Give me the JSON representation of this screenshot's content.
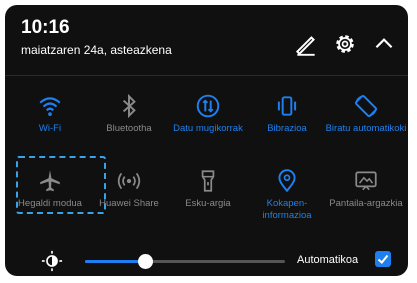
{
  "header": {
    "time": "10:16",
    "date": "maiatzaren 24a, asteazkena",
    "edit_icon": "pencil-edit-icon",
    "settings_icon": "gear-icon",
    "collapse_icon": "chevron-up-icon"
  },
  "tiles": [
    {
      "label": "Wi-Fi",
      "icon": "wifi-icon",
      "active": true
    },
    {
      "label": "Bluetootha",
      "icon": "bluetooth-icon",
      "active": false
    },
    {
      "label": "Datu mugikorrak",
      "icon": "mobile-data-icon",
      "active": true
    },
    {
      "label": "Bibrazioa",
      "icon": "vibration-icon",
      "active": true
    },
    {
      "label": "Biratu automatikoki",
      "icon": "auto-rotate-icon",
      "active": true
    },
    {
      "label": "Hegaldi modua",
      "icon": "airplane-icon",
      "active": false
    },
    {
      "label": "Huawei Share",
      "icon": "huawei-share-icon",
      "active": false
    },
    {
      "label": "Esku-argia",
      "icon": "flashlight-icon",
      "active": false
    },
    {
      "label": "Kokapen-informazioa",
      "icon": "location-icon",
      "active": true
    },
    {
      "label": "Pantaila-argazkia",
      "icon": "screenshot-icon",
      "active": false
    }
  ],
  "brightness": {
    "icon": "brightness-icon",
    "level": 0.3,
    "auto_label": "Automatikoa",
    "auto_checked": true
  },
  "colors": {
    "accent": "#1e80f0",
    "panel": "#101010",
    "inactive": "#8a8a8a",
    "focus_outline": "#3aa0e8"
  }
}
